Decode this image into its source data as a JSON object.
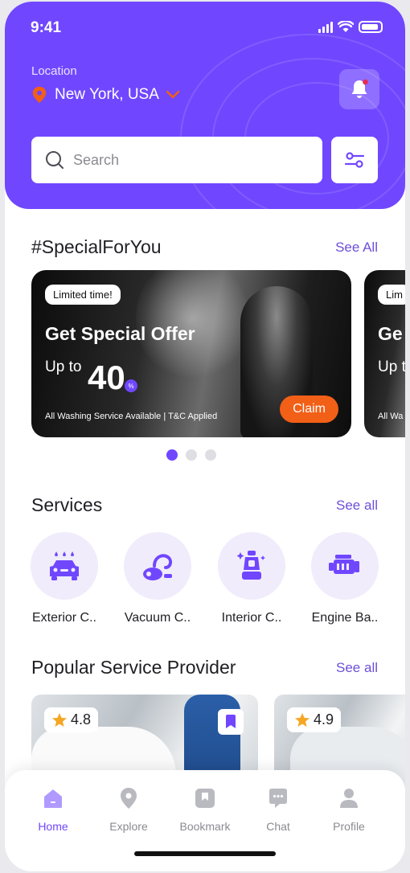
{
  "status_bar": {
    "time": "9:41"
  },
  "header": {
    "location_label": "Location",
    "location_value": "New York, USA",
    "search_placeholder": "Search"
  },
  "special": {
    "title": "#SpecialForYou",
    "see_all": "See All",
    "banner": {
      "badge": "Limited time!",
      "title": "Get Special Offer",
      "up_to": "Up to",
      "amount": "40",
      "percent_sign": "%",
      "fine_print": "All Washing Service Available | T&C Applied",
      "cta": "Claim"
    },
    "peek_banner": {
      "badge": "Lim",
      "title": "Ge",
      "up_to": "Up t",
      "fine_print": "All Wa"
    },
    "carousel_active_index": 0,
    "carousel_count": 3
  },
  "services": {
    "title": "Services",
    "see_all": "See all",
    "items": [
      {
        "label": "Exterior C..",
        "icon": "car-wash-icon"
      },
      {
        "label": "Vacuum C..",
        "icon": "vacuum-icon"
      },
      {
        "label": "Interior C..",
        "icon": "car-seat-icon"
      },
      {
        "label": "Engine Ba..",
        "icon": "engine-icon"
      }
    ]
  },
  "providers": {
    "title": "Popular Service Provider",
    "see_all": "See all",
    "cards": [
      {
        "rating": "4.8",
        "bookmarked": true
      },
      {
        "rating": "4.9",
        "bookmarked": false
      }
    ]
  },
  "bottom_nav": {
    "items": [
      {
        "label": "Home",
        "icon": "home-icon",
        "active": true
      },
      {
        "label": "Explore",
        "icon": "location-pin-icon",
        "active": false
      },
      {
        "label": "Bookmark",
        "icon": "bookmark-icon",
        "active": false
      },
      {
        "label": "Chat",
        "icon": "chat-icon",
        "active": false
      },
      {
        "label": "Profile",
        "icon": "profile-icon",
        "active": false
      }
    ]
  },
  "colors": {
    "primary": "#7047ff",
    "accent_orange": "#f25f16",
    "notification_dot": "#e52b50",
    "star": "#f5a623",
    "text_dark": "#1f1f24",
    "text_muted": "#8a8a92"
  }
}
